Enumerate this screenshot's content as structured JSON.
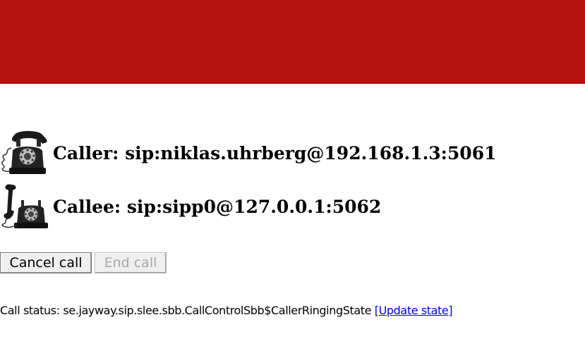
{
  "banner": {
    "color": "#b3120d"
  },
  "caller": {
    "label": "Caller: sip:niklas.uhrberg@192.168.1.3:5061",
    "icon": "rotary-phone-icon"
  },
  "callee": {
    "label": "Callee: sip:sipp0@127.0.0.1:5062",
    "icon": "rotary-phone-off-hook-icon"
  },
  "actions": {
    "cancel_label": "Cancel call",
    "end_label": "End call"
  },
  "status": {
    "prefix": "Call status: ",
    "value": "se.jayway.sip.slee.sbb.CallControlSbb$CallerRingingState",
    "update_link": "[Update state]"
  }
}
